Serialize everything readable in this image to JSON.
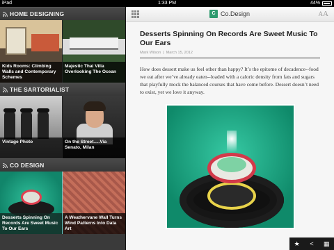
{
  "status": {
    "carrier": "iPad",
    "time": "1:33 PM",
    "battery": "44%"
  },
  "sections": [
    {
      "title": "HOME DESIGNING",
      "tiles": [
        {
          "caption": "Kids Rooms: Climbing Walls and Contemporary Schemes"
        },
        {
          "caption": "Majestic Thai Villa Overlooking The Ocean"
        }
      ]
    },
    {
      "title": "THE SARTORIALIST",
      "tiles": [
        {
          "caption": "Vintage Photo"
        },
        {
          "caption": "On the Street.....Via Senato, Milan"
        }
      ]
    },
    {
      "title": "CO DESIGN",
      "tiles": [
        {
          "caption": "Desserts Spinning On Records Are Sweet Music To Our Ears"
        },
        {
          "caption": "A Weathervane Wall Turns Wind Patterns Into Data Art"
        }
      ]
    }
  ],
  "reader": {
    "source": "Co.Design",
    "logo_letter": "C",
    "font_size_small": "A",
    "font_size_big": "A"
  },
  "article": {
    "title": "Desserts Spinning On Records Are Sweet Music To Our Ears",
    "author": "Mark Wilson",
    "date": "March 15, 2012",
    "separator": "|",
    "body": "How does dessert make us feel other than happy? It’s the epitome of decadence--food we eat after we’ve already eaten--loaded with a caloric density from fats and sugars that playfully mock the balanced courses that have come before. Dessert doesn’t need to exist, yet we love it anyway."
  },
  "toolbar": {
    "star_icon": "★",
    "share_icon": "<",
    "grid_icon": "▦"
  },
  "colors": {
    "accent": "#2e9a6e",
    "sidebar": "#3a3a3a",
    "reader_bg": "#f6f6f6"
  }
}
